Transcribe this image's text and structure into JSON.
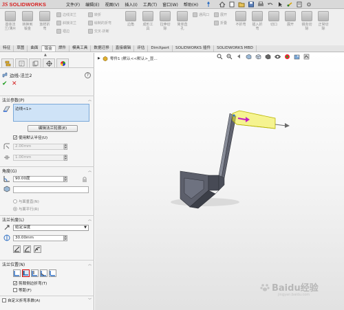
{
  "app": {
    "brand_ds": "3S",
    "brand_name": "SOLIDWORKS"
  },
  "menubar": [
    "文件(F)",
    "编辑(E)",
    "视图(V)",
    "插入(I)",
    "工具(T)",
    "窗口(W)",
    "帮助(H)"
  ],
  "ribbon": {
    "big": [
      {
        "label": "基体法\n兰/薄片"
      },
      {
        "label": "转换到\n钣金"
      },
      {
        "label": "放样折\n弯"
      }
    ],
    "col1": [
      "边线法兰",
      "斜接法兰",
      "褶边"
    ],
    "col2": [
      "转折",
      "绘制的折弯",
      "交叉-折断"
    ],
    "big2": [
      {
        "label": "边角"
      }
    ],
    "big3": [
      {
        "label": "成形工\n具"
      },
      {
        "label": "拉伸切\n除"
      },
      {
        "label": "简单直\n孔"
      }
    ],
    "col3": [
      "通风口",
      "",
      ""
    ],
    "col4": [
      "展开",
      "折叠",
      ""
    ],
    "big4": [
      {
        "label": "不折弯"
      },
      {
        "label": "插入折\n弯"
      },
      {
        "label": "切口"
      },
      {
        "label": "展开"
      },
      {
        "label": "镜向切\n除"
      },
      {
        "label": "正常切\n除"
      }
    ]
  },
  "tabs": [
    "特征",
    "草图",
    "曲面",
    "钣金",
    "焊件",
    "模具工具",
    "数据迁移",
    "直接编辑",
    "评估",
    "DimXpert",
    "SOLIDWORKS 插件",
    "SOLIDWORKS MBD"
  ],
  "active_tab": "钣金",
  "panel": {
    "title": "边线-法兰2",
    "help": "?",
    "ok": "✔",
    "cancel": "✕",
    "flange_params": {
      "header": "法兰参数(P)",
      "edge_item": "边线<1>",
      "edit_profile_label": "编辑法兰轮廓(E)",
      "use_default_radius": "使用默认半径(U)",
      "radius_value": "2.00mm",
      "gap_value": "1.00mm"
    },
    "angle": {
      "header": "角度(G)",
      "angle_value": "90.00度",
      "face_value": "",
      "opt_perpendicular": "与面垂直(N)",
      "opt_parallel": "与面平行(R)"
    },
    "length": {
      "header": "法兰长度(L)",
      "end_condition": "给定深度",
      "length_value": "30.00mm"
    },
    "position": {
      "header": "法兰位置(N)",
      "trim_side_bends": "剪裁侧边折弯(T)",
      "offset": "等距(F)"
    },
    "custom_bend": "自定义折弯系数(A)"
  },
  "viewport": {
    "tree_label": "零件1  (默认<<默认>_显..."
  },
  "watermark": {
    "text": "Baidu经验",
    "url": "jingyan.baidu.com"
  },
  "colors": {
    "accent_red": "#d81e1e",
    "ok_green": "#1c9c1c",
    "selection_blue": "#cfe3f7",
    "highlight_yellow": "#f2ee3a",
    "arrow_magenta": "#c21ec2"
  }
}
